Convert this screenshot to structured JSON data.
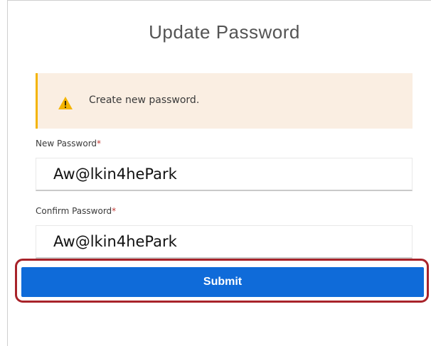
{
  "form": {
    "title": "Update Password",
    "alert": {
      "icon": "warning-icon",
      "message": "Create new password."
    },
    "new_password": {
      "label": "New Password",
      "required_mark": "*",
      "value": "Aw@lkin4hePark"
    },
    "confirm_password": {
      "label": "Confirm Password",
      "required_mark": "*",
      "value": "Aw@lkin4hePark"
    },
    "submit_label": "Submit"
  },
  "colors": {
    "accent": "#0f6bd9",
    "warning": "#f4b400",
    "alert_background": "#faeee2",
    "required": "#c23934",
    "highlight_outline": "#a8232a"
  }
}
